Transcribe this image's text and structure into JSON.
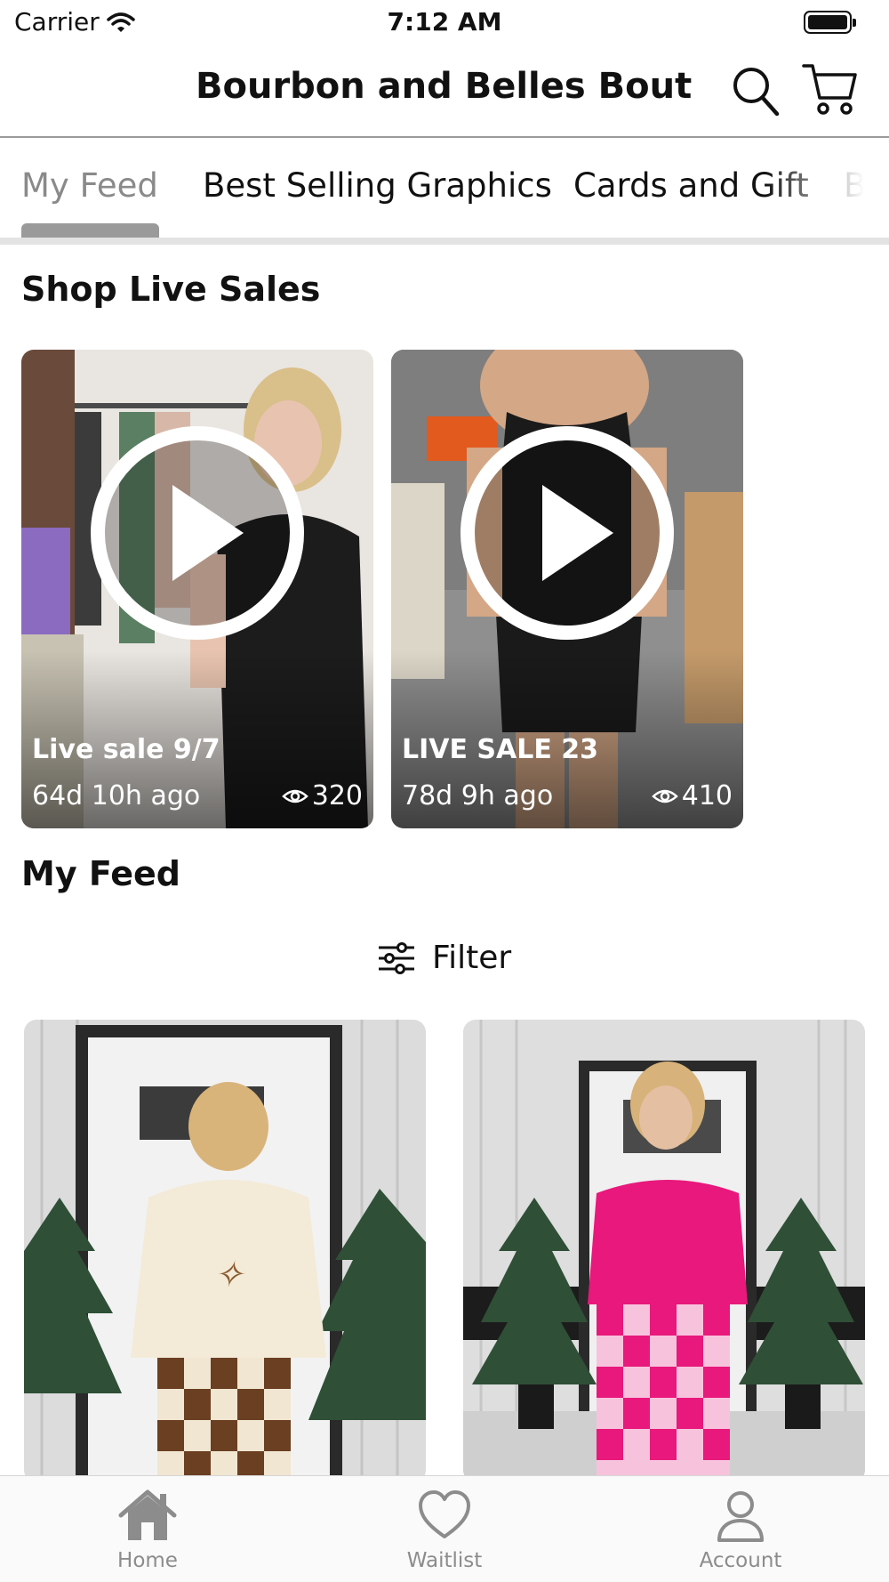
{
  "status_bar": {
    "carrier": "Carrier",
    "time": "7:12 AM"
  },
  "header": {
    "title": "Bourbon and Belles Bout..."
  },
  "categories": [
    {
      "label": "My Feed",
      "active": true
    },
    {
      "label": "Best Selling Graphics",
      "active": false
    },
    {
      "label": "Cards and Gift",
      "active": false
    },
    {
      "label": "B",
      "active": false
    }
  ],
  "live_sales": {
    "heading": "Shop Live Sales",
    "items": [
      {
        "title": "Live sale 9/7",
        "age": "64d 10h ago",
        "views": "320"
      },
      {
        "title": "LIVE SALE 23",
        "age": "78d 9h ago",
        "views": "410"
      }
    ]
  },
  "feed": {
    "heading": "My Feed",
    "filter_label": "Filter"
  },
  "tab_bar": {
    "items": [
      {
        "label": "Home",
        "icon": "home-icon"
      },
      {
        "label": "Waitlist",
        "icon": "heart-icon"
      },
      {
        "label": "Account",
        "icon": "person-icon"
      }
    ]
  },
  "colors": {
    "tab_indicator": "#9a9a9a",
    "inactive_icon": "#8c8c8c",
    "accent_pink": "#e8187c"
  }
}
